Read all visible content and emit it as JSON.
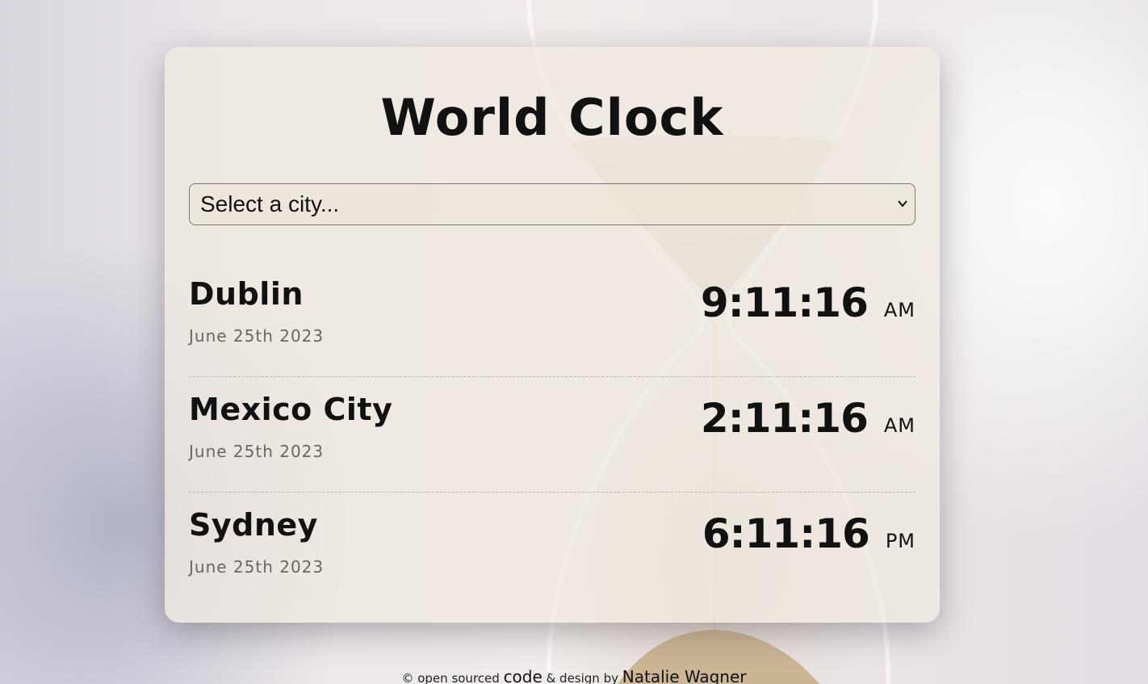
{
  "app": {
    "title": "World Clock"
  },
  "city_select": {
    "selected": "Select a city..."
  },
  "cities": [
    {
      "name": "Dublin",
      "date": "June 25th 2023",
      "time": "9:11:16",
      "ampm": "AM"
    },
    {
      "name": "Mexico City",
      "date": "June 25th 2023",
      "time": "2:11:16",
      "ampm": "AM"
    },
    {
      "name": "Sydney",
      "date": "June 25th 2023",
      "time": "6:11:16",
      "ampm": "PM"
    }
  ],
  "footer": {
    "prefix": "© open sourced",
    "code_link": "code",
    "middle": "& design by",
    "author_link": "Natalie Wagner"
  },
  "colors": {
    "card": "#f0e9e0",
    "text": "#111111",
    "date_text": "#6b665f"
  }
}
